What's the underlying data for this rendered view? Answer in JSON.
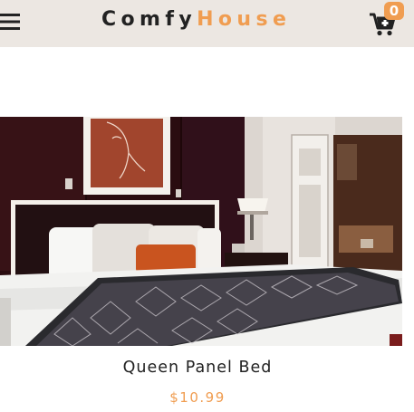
{
  "navbar": {
    "menu_icon": "hamburger-menu-icon",
    "logo_part1": "Comfy",
    "logo_part2": "House",
    "cart_icon": "cart-plus-icon",
    "cart_count": "0"
  },
  "product": {
    "title": "Queen Panel Bed",
    "price": "$10.99"
  },
  "colors": {
    "navbar_bg": "#ece7e2",
    "accent": "#f09d51",
    "text": "#222222"
  }
}
